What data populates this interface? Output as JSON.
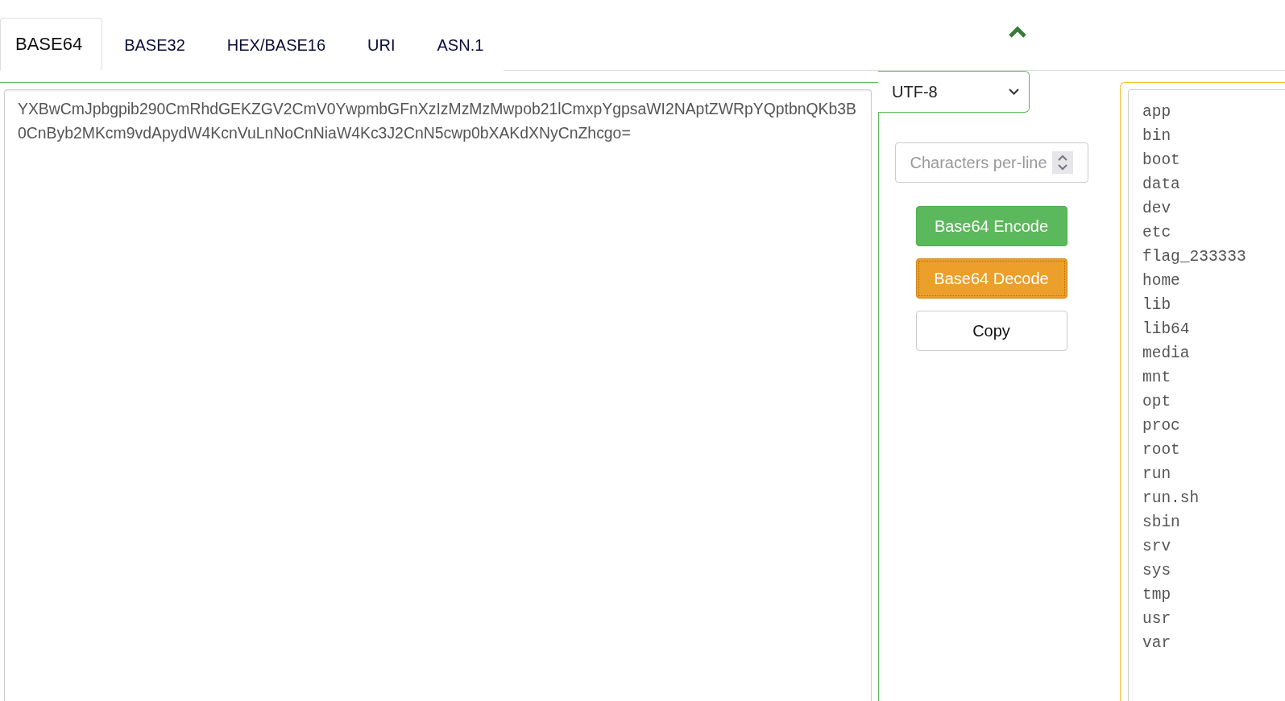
{
  "tabs": [
    {
      "label": "BASE64",
      "selected": true
    },
    {
      "label": "BASE32",
      "selected": false
    },
    {
      "label": "HEX/BASE16",
      "selected": false
    },
    {
      "label": "URI",
      "selected": false
    },
    {
      "label": "ASN.1",
      "selected": false
    }
  ],
  "editor": {
    "value": "YXBwCmJpbgpib290CmRhdGEKZGV2CmV0YwpmbGFnXzIzMzMzMwpob21lCmxpYgpsaWI2NAptZWRpYQptbnQKb3B0CnByb2MKcm9vdApydW4KcnVuLnNoCnNiaW4Kc3J2CnN5cwp0bXAKdXNyCnZhcgo="
  },
  "charset": {
    "value": "UTF-8"
  },
  "line_length": {
    "placeholder": "Characters per-line"
  },
  "buttons": [
    {
      "label": "Base64 Encode",
      "kind": "primary"
    },
    {
      "label": "Base64 Decode",
      "kind": "warning"
    },
    {
      "label": "Copy",
      "kind": "default"
    }
  ],
  "output": {
    "lines": [
      "app",
      "bin",
      "boot",
      "data",
      "dev",
      "etc",
      "flag_233333",
      "home",
      "lib",
      "lib64",
      "media",
      "mnt",
      "opt",
      "proc",
      "root",
      "run",
      "run.sh",
      "sbin",
      "srv",
      "sys",
      "tmp",
      "usr",
      "var"
    ]
  }
}
